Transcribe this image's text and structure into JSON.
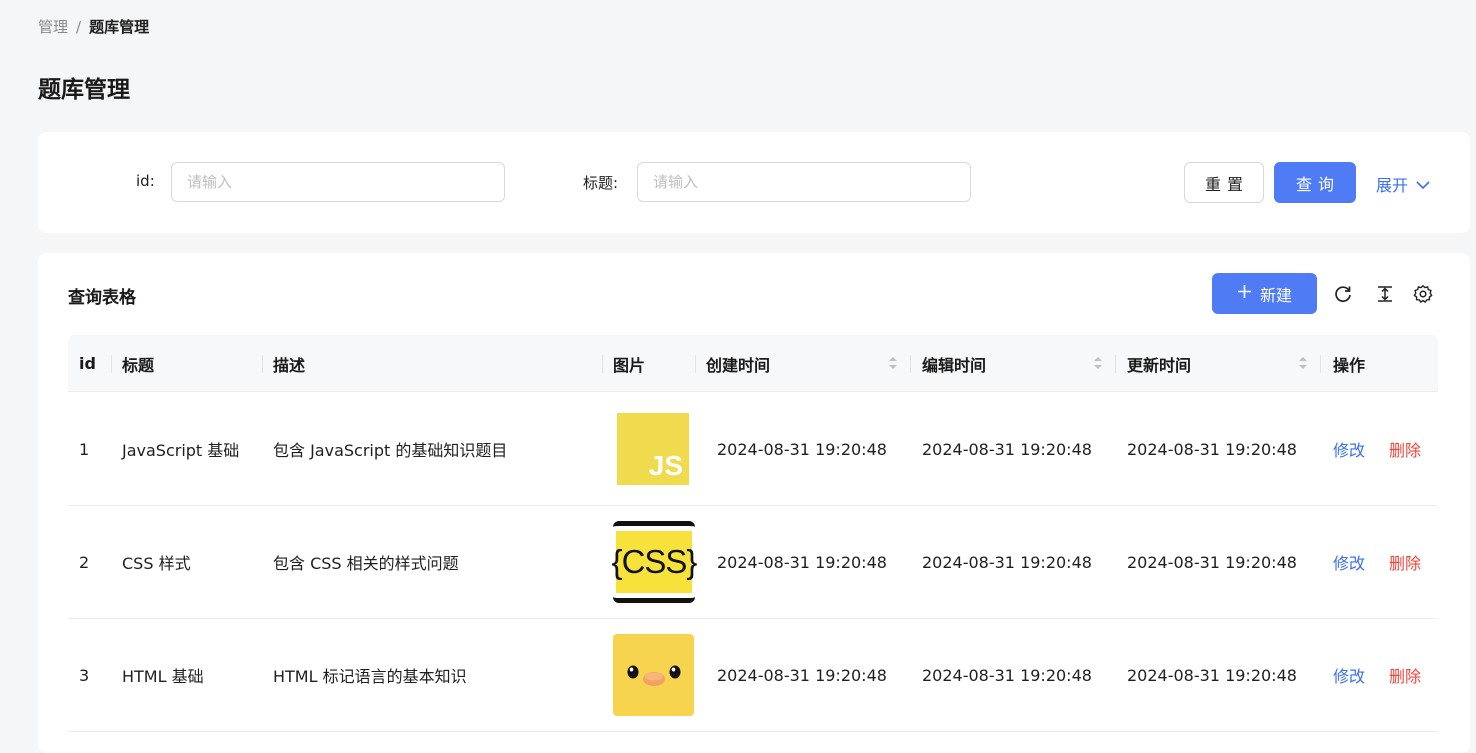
{
  "breadcrumb": {
    "parent": "管理",
    "separator": "/",
    "current": "题库管理"
  },
  "page": {
    "title": "题库管理"
  },
  "search": {
    "id_label": "id:",
    "id_placeholder": "请输入",
    "title_label": "标题:",
    "title_placeholder": "请输入",
    "reset_label": "重置",
    "query_label": "查询",
    "expand_label": "展开"
  },
  "table": {
    "card_title": "查询表格",
    "new_label": "新建",
    "toolbar_icons": [
      "reload-icon",
      "density-icon",
      "settings-icon"
    ],
    "columns": {
      "id": "id",
      "title": "标题",
      "description": "描述",
      "picture": "图片",
      "created": "创建时间",
      "edited": "编辑时间",
      "updated": "更新时间",
      "actions": "操作"
    },
    "rows": [
      {
        "id": "1",
        "title": "JavaScript 基础",
        "description": "包含 JavaScript 的基础知识题目",
        "picture": "js-logo",
        "picture_text": "JS",
        "created": "2024-08-31 19:20:48",
        "edited": "2024-08-31 19:20:48",
        "updated": "2024-08-31 19:20:48",
        "edit_label": "修改",
        "delete_label": "删除"
      },
      {
        "id": "2",
        "title": "CSS 样式",
        "description": "包含 CSS 相关的样式问题",
        "picture": "css-logo",
        "picture_text": "{CSS}",
        "created": "2024-08-31 19:20:48",
        "edited": "2024-08-31 19:20:48",
        "updated": "2024-08-31 19:20:48",
        "edit_label": "修改",
        "delete_label": "删除"
      },
      {
        "id": "3",
        "title": "HTML 基础",
        "description": "HTML 标记语言的基本知识",
        "picture": "duck-avatar",
        "created": "2024-08-31 19:20:48",
        "edited": "2024-08-31 19:20:48",
        "updated": "2024-08-31 19:20:48",
        "edit_label": "修改",
        "delete_label": "删除"
      }
    ]
  },
  "colors": {
    "primary": "#4f7cf4",
    "link": "#3a6ff4",
    "danger": "#f0453a",
    "js_yellow": "#f0db4f",
    "css_yellow": "#f7e23c",
    "duck_bg": "#f6d44e"
  }
}
